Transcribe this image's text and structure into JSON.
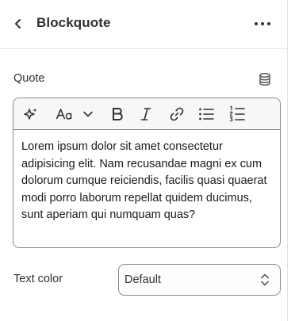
{
  "header": {
    "title": "Blockquote",
    "back_icon": "chevron-left-icon",
    "more_icon": "horizontal-dots-icon"
  },
  "quote_field": {
    "label": "Quote",
    "source_icon": "database-icon",
    "toolbar": [
      "sparkle-icon",
      "text-style-icon",
      "chevron-down-icon",
      "bold-icon",
      "italic-icon",
      "link-icon",
      "bullet-list-icon",
      "numbered-list-icon"
    ],
    "value": "Lorem ipsum dolor sit amet consectetur adipisicing elit. Nam recusandae magni ex cum dolorum cumque reiciendis, facilis quasi quaerat modi porro laborum repellat quidem ducimus, sunt aperiam qui numquam quas?"
  },
  "text_color": {
    "label": "Text color",
    "selected": "Default",
    "icon": "select-chevron-icon"
  }
}
